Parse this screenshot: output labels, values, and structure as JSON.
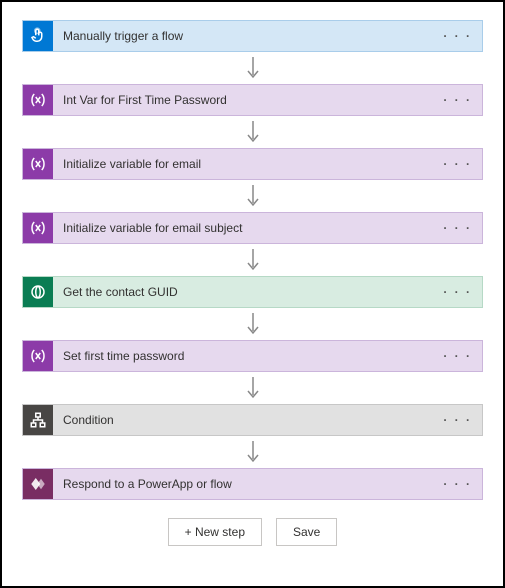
{
  "steps": [
    {
      "label": "Manually trigger a flow",
      "variant": "blue",
      "icon": "touch"
    },
    {
      "label": "Int Var for First Time Password",
      "variant": "purple",
      "icon": "var"
    },
    {
      "label": "Initialize variable for email",
      "variant": "purple",
      "icon": "var"
    },
    {
      "label": "Initialize variable for email subject",
      "variant": "purple",
      "icon": "var"
    },
    {
      "label": "Get the contact GUID",
      "variant": "green",
      "icon": "cds"
    },
    {
      "label": "Set first time password",
      "variant": "purple",
      "icon": "var"
    },
    {
      "label": "Condition",
      "variant": "grey",
      "icon": "cond"
    },
    {
      "label": "Respond to a PowerApp or flow",
      "variant": "maroon",
      "icon": "pa"
    }
  ],
  "footer": {
    "new_step": "+ New step",
    "save": "Save"
  }
}
